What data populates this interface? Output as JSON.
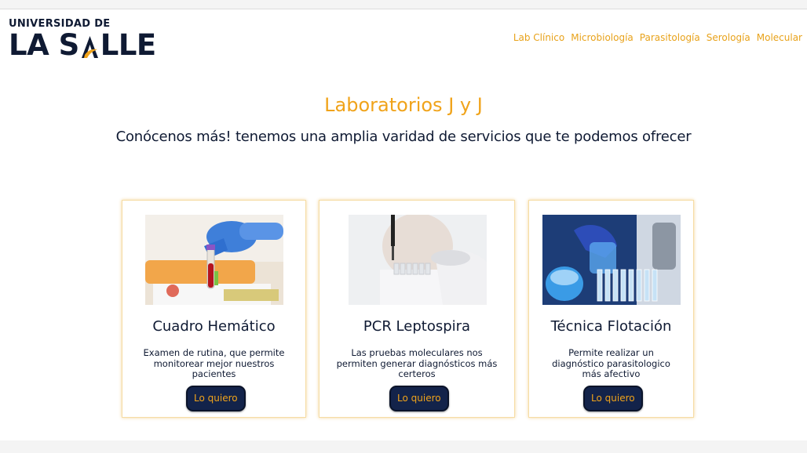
{
  "brand": {
    "line1": "UNIVERSIDAD DE",
    "big_left": "LA S",
    "big_right": "LLE"
  },
  "nav": {
    "items": [
      "Lab Clínico",
      "Microbiología",
      "Parasitología",
      "Serología",
      "Molecular"
    ]
  },
  "hero": {
    "title": "Laboratorios J y J",
    "subtitle": "Conócenos más! tenemos una amplia varidad de servicios que te podemos ofrecer"
  },
  "cards": [
    {
      "title": "Cuadro Hemático",
      "description": "Examen de rutina, que permite monitorear mejor nuestros pacientes",
      "button": "Lo quiero"
    },
    {
      "title": "PCR Leptospira",
      "description": "Las pruebas moleculares nos permiten generar diagnósticos más certeros",
      "button": "Lo quiero"
    },
    {
      "title": "Técnica Flotación",
      "description": "Permite realizar un diagnóstico parasitologico más afectivo",
      "button": "Lo quiero"
    }
  ],
  "colors": {
    "accent": "#f0a31a",
    "navy": "#13234a",
    "card_border": "#f6dca4"
  }
}
